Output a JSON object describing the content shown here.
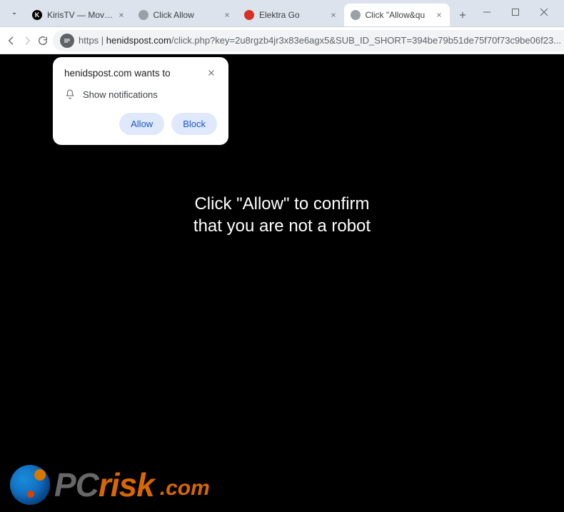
{
  "titlebar": {
    "tabs": [
      {
        "title": "KirisTV — Movies and"
      },
      {
        "title": "Click Allow"
      },
      {
        "title": "Elektra Go"
      },
      {
        "title": "Click &quot;Allow&qu"
      }
    ]
  },
  "toolbar": {
    "url_prefix": "https",
    "url_host": "henidspost.com",
    "url_path": "/click.php?key=2u8rgzb4jr3x83e6agx5&SUB_ID_SHORT=394be79b51de75f70f73c9be06f23..."
  },
  "notification": {
    "heading": "henidspost.com wants to",
    "permission": "Show notifications",
    "allow_label": "Allow",
    "block_label": "Block"
  },
  "page": {
    "line1": "Click \"Allow\" to confirm",
    "line2": "that you are not a robot"
  },
  "watermark": {
    "pc": "PC",
    "risk": "risk",
    "domain": ".com"
  }
}
